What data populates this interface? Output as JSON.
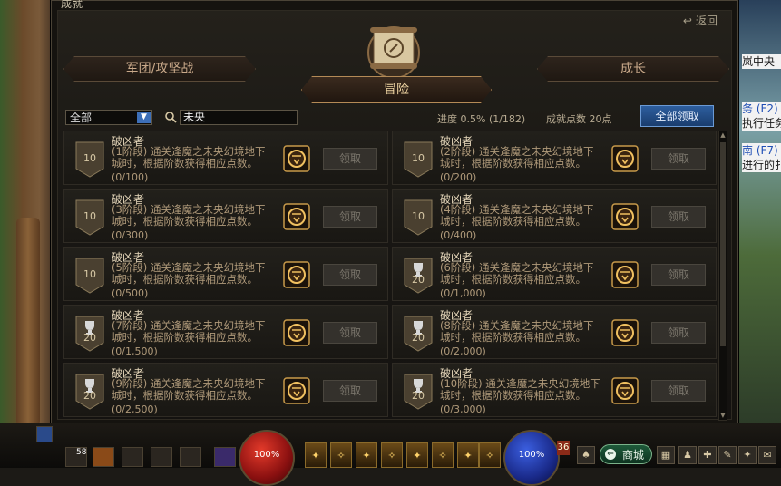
{
  "window": {
    "title": "成就",
    "back_label": "返回"
  },
  "tabs": [
    {
      "label": "军团/攻坚战",
      "active": false
    },
    {
      "label": "冒险",
      "active": true
    },
    {
      "label": "成长",
      "active": false
    }
  ],
  "filter": {
    "category_selected": "全部",
    "search_value": "未央"
  },
  "progress": {
    "text": "进度  0.5% (1/182)"
  },
  "points": {
    "text": "成就点数 20点"
  },
  "claim_all_label": "全部领取",
  "achievements": [
    {
      "name": "破凶者",
      "desc": "(1阶段) 通关逢魔之未央幻境地下城时，根据阶数获得相应点数。",
      "count": "(0/100)",
      "badge": "10",
      "badge_type": "plain",
      "claim": "领取"
    },
    {
      "name": "破凶者",
      "desc": "(2阶段) 通关逢魔之未央幻境地下城时，根据阶数获得相应点数。",
      "count": "(0/200)",
      "badge": "10",
      "badge_type": "plain",
      "claim": "领取"
    },
    {
      "name": "破凶者",
      "desc": "(3阶段) 通关逢魔之未央幻境地下城时，根据阶数获得相应点数。",
      "count": "(0/300)",
      "badge": "10",
      "badge_type": "plain",
      "claim": "领取"
    },
    {
      "name": "破凶者",
      "desc": "(4阶段) 通关逢魔之未央幻境地下城时，根据阶数获得相应点数。",
      "count": "(0/400)",
      "badge": "10",
      "badge_type": "plain",
      "claim": "领取"
    },
    {
      "name": "破凶者",
      "desc": "(5阶段) 通关逢魔之未央幻境地下城时，根据阶数获得相应点数。",
      "count": "(0/500)",
      "badge": "10",
      "badge_type": "plain",
      "claim": "领取"
    },
    {
      "name": "破凶者",
      "desc": "(6阶段) 通关逢魔之未央幻境地下城时，根据阶数获得相应点数。",
      "count": "(0/1,000)",
      "badge": "20",
      "badge_type": "trophy",
      "claim": "领取"
    },
    {
      "name": "破凶者",
      "desc": "(7阶段) 通关逢魔之未央幻境地下城时，根据阶数获得相应点数。",
      "count": "(0/1,500)",
      "badge": "20",
      "badge_type": "trophy",
      "claim": "领取"
    },
    {
      "name": "破凶者",
      "desc": "(8阶段) 通关逢魔之未央幻境地下城时，根据阶数获得相应点数。",
      "count": "(0/2,000)",
      "badge": "20",
      "badge_type": "trophy",
      "claim": "领取"
    },
    {
      "name": "破凶者",
      "desc": "(9阶段) 通关逢魔之未央幻境地下城时，根据阶数获得相应点数。",
      "count": "(0/2,500)",
      "badge": "20",
      "badge_type": "trophy",
      "claim": "领取"
    },
    {
      "name": "破凶者",
      "desc": "(10阶段) 通关逢魔之未央幻境地下城时，根据阶数获得相应点数。",
      "count": "(0/3,000)",
      "badge": "20",
      "badge_type": "trophy",
      "claim": "领取"
    }
  ],
  "side_panel": [
    {
      "text": "岚中央"
    },
    {
      "text": "务 (F2)"
    },
    {
      "text": "执行任务"
    },
    {
      "text": "南 (F7)"
    },
    {
      "text": "进行的扌"
    }
  ],
  "hud": {
    "hp_text": "100%",
    "mp_text": "100%",
    "level": "36",
    "shop_label": "商城",
    "item_count": "58"
  }
}
